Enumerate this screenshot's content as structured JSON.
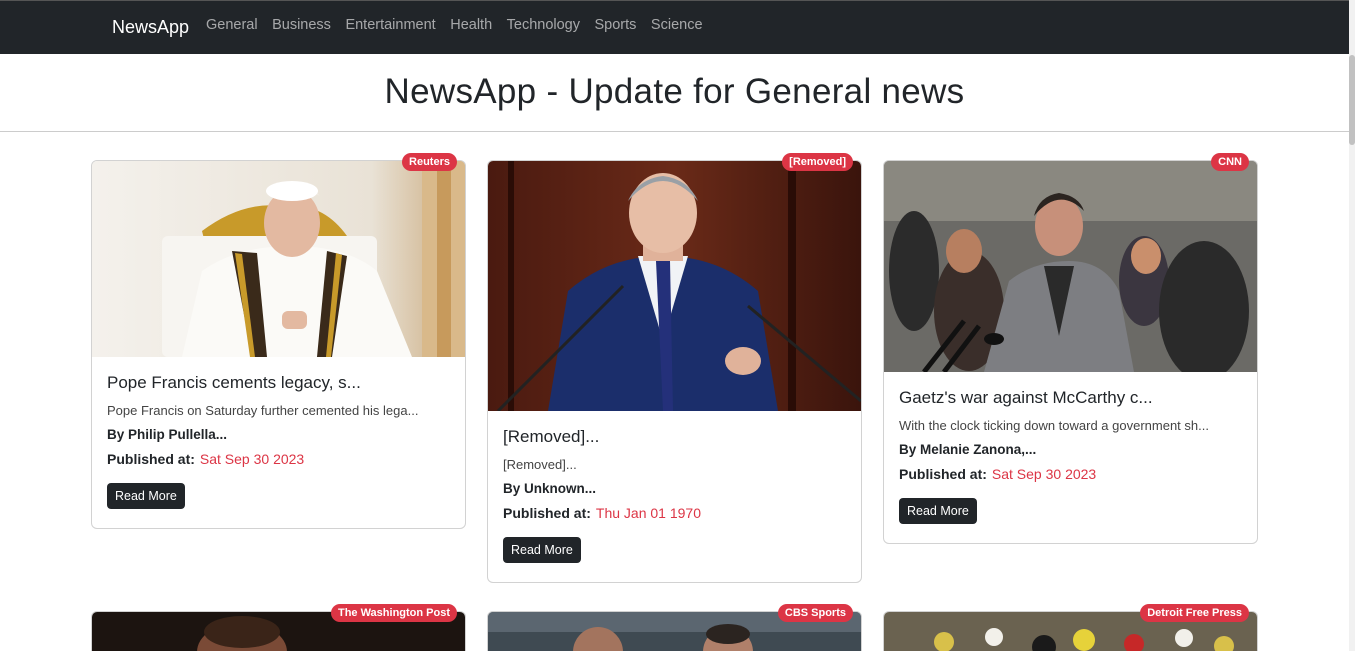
{
  "navbar": {
    "brand": "NewsApp",
    "links": [
      "General",
      "Business",
      "Entertainment",
      "Health",
      "Technology",
      "Sports",
      "Science"
    ]
  },
  "heading": "NewsApp - Update for General news",
  "cards": [
    {
      "source": "Reuters",
      "title": "Pope Francis cements legacy, s...",
      "description": "Pope Francis on Saturday further cemented his lega...",
      "author": "By Philip Pullella...",
      "published_label": "Published at:",
      "date": "Sat Sep 30 2023",
      "button": "Read More"
    },
    {
      "source": "[Removed]",
      "title": "[Removed]...",
      "description": "[Removed]...",
      "author": "By Unknown...",
      "published_label": "Published at:",
      "date": "Thu Jan 01 1970",
      "button": "Read More"
    },
    {
      "source": "CNN",
      "title": "Gaetz's war against McCarthy c...",
      "description": "With the clock ticking down toward a government sh...",
      "author": "By Melanie Zanona,...",
      "published_label": "Published at:",
      "date": "Sat Sep 30 2023",
      "button": "Read More"
    },
    {
      "source": "The Washington Post"
    },
    {
      "source": "CBS Sports"
    },
    {
      "source": "Detroit Free Press"
    }
  ],
  "colors": {
    "navbar": "#212529",
    "badge": "#dc3545",
    "date": "#dc3545"
  }
}
